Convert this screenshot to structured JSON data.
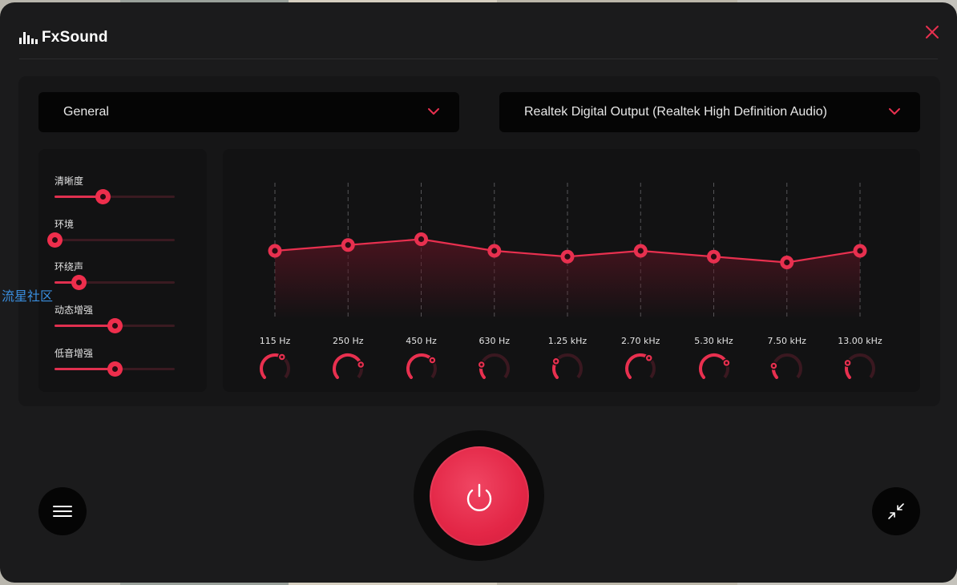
{
  "app": {
    "name": "FxSound"
  },
  "colors": {
    "accent": "#e8304f",
    "window_bg": "#1b1b1c",
    "panel_bg": "#161617",
    "control_bg": "#050505"
  },
  "preset_dropdown": {
    "selected": "General"
  },
  "output_dropdown": {
    "selected": "Realtek Digital Output (Realtek High Definition Audio)"
  },
  "effects": [
    {
      "label": "清晰度",
      "value": 0.4
    },
    {
      "label": "环境",
      "value": 0.0
    },
    {
      "label": "环绕声",
      "value": 0.2
    },
    {
      "label": "动态增强",
      "value": 0.5
    },
    {
      "label": "低音增强",
      "value": 0.5
    }
  ],
  "equalizer": {
    "bands": [
      {
        "label": "115 Hz",
        "gain": 0.0
      },
      {
        "label": "250 Hz",
        "gain": 0.5
      },
      {
        "label": "450 Hz",
        "gain": 1.0
      },
      {
        "label": "630 Hz",
        "gain": 0.0
      },
      {
        "label": "1.25 kHz",
        "gain": -0.5
      },
      {
        "label": "2.70 kHz",
        "gain": 0.0
      },
      {
        "label": "5.30 kHz",
        "gain": -0.5
      },
      {
        "label": "7.50 kHz",
        "gain": -1.0
      },
      {
        "label": "13.00 kHz",
        "gain": 0.0
      }
    ],
    "knobs": [
      0.62,
      0.78,
      0.7,
      0.22,
      0.28,
      0.65,
      0.75,
      0.2,
      0.25
    ]
  },
  "watermark": "流星社区",
  "icons": {
    "logo": "equalizer-bars-icon",
    "close": "close-icon",
    "dropdown": "chevron-down-icon",
    "menu": "hamburger-menu-icon",
    "power": "power-icon",
    "minimize": "collapse-arrows-icon"
  }
}
